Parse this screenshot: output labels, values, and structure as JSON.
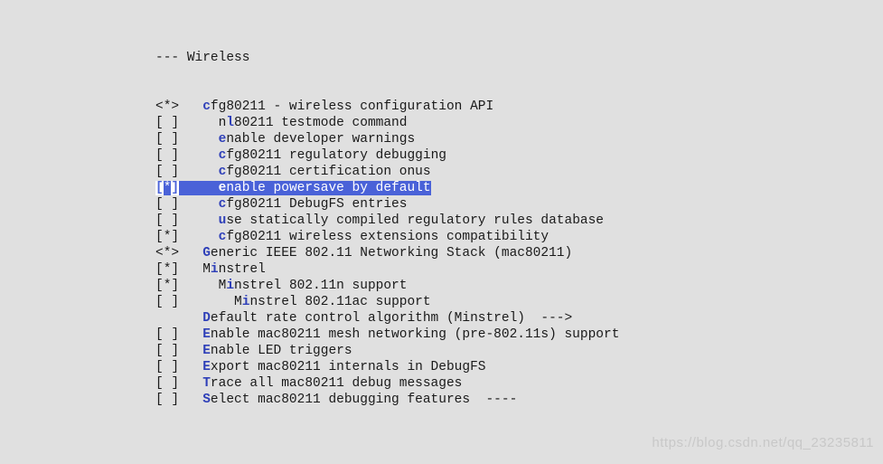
{
  "header": {
    "prefix": "--- ",
    "title": "Wireless"
  },
  "items": [
    {
      "marker": "<*>",
      "indent": 3,
      "hotkey": "c",
      "text": "fg80211 - wireless configuration API",
      "selected": false
    },
    {
      "marker": "[ ]",
      "indent": 5,
      "hotkey": "l",
      "pre": "n",
      "text": "80211 testmode command",
      "selected": false
    },
    {
      "marker": "[ ]",
      "indent": 5,
      "hotkey": "e",
      "text": "nable developer warnings",
      "selected": false
    },
    {
      "marker": "[ ]",
      "indent": 5,
      "hotkey": "c",
      "text": "fg80211 regulatory debugging",
      "selected": false
    },
    {
      "marker": "[ ]",
      "indent": 5,
      "hotkey": "c",
      "text": "fg80211 certification onus",
      "selected": false
    },
    {
      "marker": "[*]",
      "indent": 5,
      "hotkey": "e",
      "text": "nable powersave by default",
      "selected": true
    },
    {
      "marker": "[ ]",
      "indent": 5,
      "hotkey": "c",
      "text": "fg80211 DebugFS entries",
      "selected": false
    },
    {
      "marker": "[ ]",
      "indent": 5,
      "hotkey": "u",
      "text": "se statically compiled regulatory rules database",
      "selected": false
    },
    {
      "marker": "[*]",
      "indent": 5,
      "hotkey": "c",
      "text": "fg80211 wireless extensions compatibility",
      "selected": false
    },
    {
      "marker": "<*>",
      "indent": 3,
      "hotkey": "G",
      "text": "eneric IEEE 802.11 Networking Stack (mac80211)",
      "selected": false
    },
    {
      "marker": "[*]",
      "indent": 3,
      "hotkey": "i",
      "pre": "M",
      "text": "nstrel",
      "selected": false
    },
    {
      "marker": "[*]",
      "indent": 5,
      "hotkey": "i",
      "pre": "M",
      "text": "nstrel 802.11n support",
      "selected": false
    },
    {
      "marker": "[ ]",
      "indent": 7,
      "hotkey": "i",
      "pre": "M",
      "text": "nstrel 802.11ac support",
      "selected": false
    },
    {
      "marker": "   ",
      "indent": 3,
      "hotkey": "D",
      "text": "efault rate control algorithm (Minstrel)  --->",
      "selected": false
    },
    {
      "marker": "[ ]",
      "indent": 3,
      "hotkey": "E",
      "text": "nable mac80211 mesh networking (pre-802.11s) support",
      "selected": false
    },
    {
      "marker": "[ ]",
      "indent": 3,
      "hotkey": "E",
      "text": "nable LED triggers",
      "selected": false
    },
    {
      "marker": "[ ]",
      "indent": 3,
      "hotkey": "E",
      "text": "xport mac80211 internals in DebugFS",
      "selected": false
    },
    {
      "marker": "[ ]",
      "indent": 3,
      "hotkey": "T",
      "text": "race all mac80211 debug messages",
      "selected": false
    },
    {
      "marker": "[ ]",
      "indent": 3,
      "hotkey": "S",
      "text": "elect mac80211 debugging features  ----",
      "selected": false
    }
  ],
  "watermark": "https://blog.csdn.net/qq_23235811"
}
